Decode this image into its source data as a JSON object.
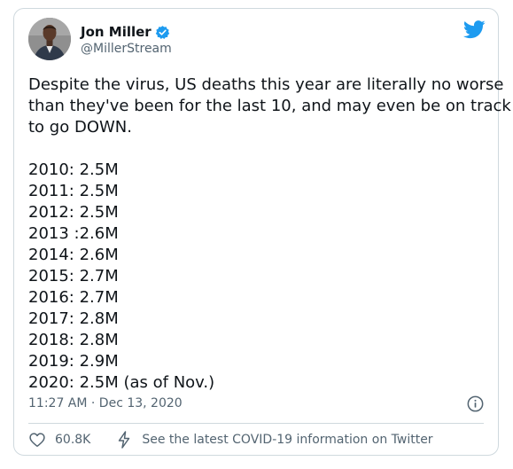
{
  "author": {
    "name": "Jon Miller",
    "handle": "@MillerStream"
  },
  "tweet": {
    "lines": [
      "Despite the virus, US deaths this year are literally no worse",
      "than they've been for the last 10, and may even be on track",
      "to go DOWN.",
      "",
      "2010: 2.5M",
      "2011: 2.5M",
      "2012: 2.5M",
      "2013 :2.6M",
      "2014: 2.6M",
      "2015: 2.7M",
      "2016: 2.7M",
      "2017: 2.8M",
      "2018: 2.8M",
      "2019: 2.9M",
      "2020: 2.5M (as of Nov.)"
    ],
    "timestamp": "11:27 AM · Dec 13, 2020"
  },
  "footer": {
    "like_count": "60.8K",
    "covid_link": "See the latest COVID-19 information on Twitter"
  },
  "icons": {
    "verified": "verified-badge-icon",
    "brand": "twitter-bird-icon",
    "info": "info-icon",
    "like": "heart-icon",
    "covid": "lightning-bolt-icon"
  },
  "colors": {
    "twitter_blue": "#1d9bf0",
    "text_primary": "#0f1419",
    "text_secondary": "#536471",
    "border": "#cfd9de"
  }
}
